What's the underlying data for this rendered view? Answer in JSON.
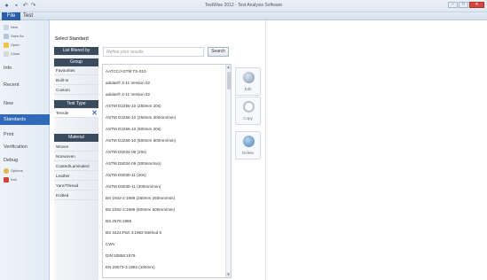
{
  "window": {
    "title": "TestWise 2012 - Test Analysis Software",
    "controls": [
      "–",
      "□",
      "✕"
    ]
  },
  "ribbon_tabs": [
    "File",
    "Test"
  ],
  "sidebar": {
    "small_items": [
      {
        "label": "New",
        "icon": "new-document-icon"
      },
      {
        "label": "Save As",
        "icon": "save-as-icon"
      },
      {
        "label": "Open",
        "icon": "folder-open-icon"
      },
      {
        "label": "Close",
        "icon": "close-document-icon"
      }
    ],
    "sections": [
      "Info",
      "Recent",
      "New",
      "Standards",
      "Print",
      "Verification",
      "Debug"
    ],
    "active": "Standards",
    "bottom_items": [
      {
        "label": "Options",
        "icon": "options-icon"
      },
      {
        "label": "Exit",
        "icon": "exit-icon"
      }
    ]
  },
  "main": {
    "header": "Select Standard",
    "filter": {
      "list_header": "List filtered by",
      "group_header": "Group",
      "groups": [
        "Favourites",
        "Built-In",
        "Custom"
      ],
      "test_type_header": "Test Type",
      "test_type_selected": "Tensile",
      "material_header": "Material",
      "materials": [
        "Woven",
        "Nonwoven",
        "Coated/Laminated",
        "Leather",
        "Yarn/Thread",
        "Knitted"
      ]
    },
    "search": {
      "placeholder": "Refine your results",
      "button": "Search"
    },
    "results": [
      "AATCC/ASTM TS-010",
      "adidas® 4-11 Version 02",
      "adidas® 4-11 Version 02",
      "ASTM D2256-10 (250mm 20s)",
      "ASTM D2256-10 (250mm 300mm/min)",
      "ASTM D2256-10 (500mm 20s)",
      "ASTM D2256-10 (500mm 600mm/min)",
      "ASTM D5034-09 (20s)",
      "ASTM D5034-09 (300mm/min)",
      "ASTM D5035-11 (20s)",
      "ASTM D5035-11 (300mm/min)",
      "BS 1932-2:1989 (250mm 250mm/min)",
      "BS 1932-2:1989 (500mm 500mm/min)",
      "BS 2576:1986",
      "BS 3424:Part 4:1982 Method 6",
      "CWV",
      "DIN 53858:1979",
      "EN 29073-3:1992 (100mm)"
    ],
    "actions": [
      {
        "label": "Edit",
        "icon": "edit-icon",
        "color": "#7f95ad"
      },
      {
        "label": "Copy",
        "icon": "copy-icon",
        "color": "#b9c3cf"
      },
      {
        "label": "Delete",
        "icon": "delete-icon",
        "color": "#4f84b8"
      }
    ]
  }
}
